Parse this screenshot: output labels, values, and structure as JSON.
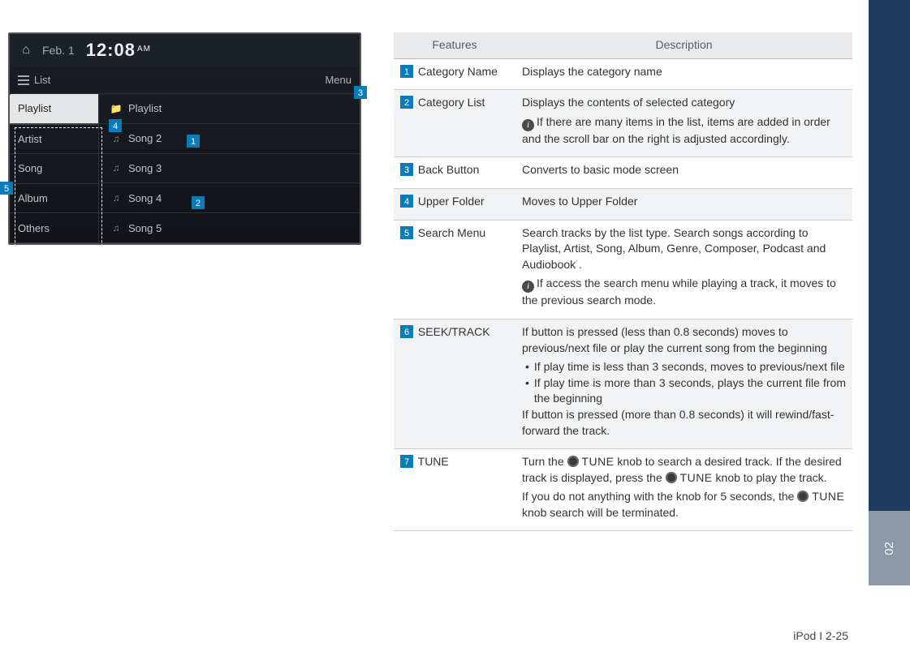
{
  "screenshot": {
    "status": {
      "date": "Feb. 1",
      "time": "12:08",
      "ampm": "AM"
    },
    "subbar": {
      "list_label": "List",
      "menu_label": "Menu"
    },
    "left_items": [
      "Playlist",
      "Artist",
      "Song",
      "Album",
      "Others"
    ],
    "right_header": "Playlist",
    "right_items": [
      "Song 2",
      "Song 3",
      "Song 4",
      "Song 5"
    ]
  },
  "callouts": {
    "c1": "1",
    "c2": "2",
    "c3": "3",
    "c4": "4",
    "c5": "5"
  },
  "table": {
    "headers": {
      "features": "Features",
      "description": "Description"
    },
    "rows": [
      {
        "num": "1",
        "feature": "Category Name",
        "desc_lines": [
          "Displays the category name"
        ]
      },
      {
        "num": "2",
        "feature": "Category List",
        "desc_lines": [
          "Displays the contents of selected category"
        ],
        "info_note": "If there are many items in the list, items are added in order and the scroll bar on the right is adjusted accordingly."
      },
      {
        "num": "3",
        "feature": "Back Button",
        "desc_lines": [
          "Converts to basic mode screen"
        ]
      },
      {
        "num": "4",
        "feature": "Upper Folder",
        "desc_lines": [
          "Moves to Upper Folder"
        ]
      },
      {
        "num": "5",
        "feature": "Search Menu",
        "desc_lines": [
          "Search tracks by the list type. Search songs according to Playlist, Artist, Song, Album, Genre, Composer, Podcast and Audiobook ."
        ],
        "info_note": "If access the search menu while playing a track, it moves to the previous search mode."
      },
      {
        "num": "6",
        "feature": "SEEK/TRACK",
        "desc_lines": [
          "If button is pressed (less than 0.8 seconds) moves to previous/next file or play the current song from the beginning"
        ],
        "bullets": [
          "If play time is less than 3 seconds, moves to previous/next file",
          "If play time is more than 3 seconds, plays the current file from the beginning"
        ],
        "desc_after": "If button is pressed (more than 0.8 seconds) it will rewind/fast-forward the track."
      },
      {
        "num": "7",
        "feature": "TUNE",
        "tune_l1a": "Turn the ",
        "tune_l1b": " knob to search a desired track.",
        "tune_l2a": "If the desired track is displayed, press the ",
        "tune_l2b": " knob to play the track.",
        "tune_l3a": "If you do not anything with the knob for 5 seconds, the ",
        "tune_l3b": " knob search will be terminated.",
        "tune_word": "TUNE"
      }
    ]
  },
  "side_tab_label": "02",
  "footer": "iPod I 2-25"
}
